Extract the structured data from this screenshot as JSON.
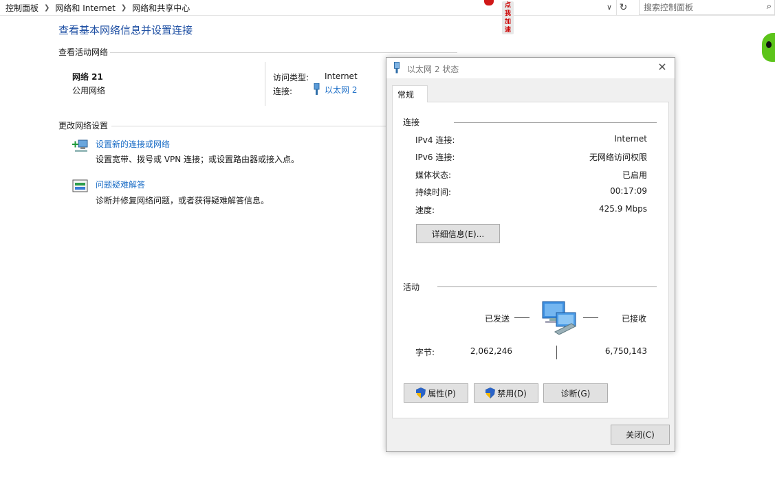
{
  "breadcrumb": [
    "控制面板",
    "网络和 Internet",
    "网络和共享中心"
  ],
  "promo": {
    "label": "点我加速",
    "color": "#d01818"
  },
  "search": {
    "placeholder": "搜索控制面板",
    "icon": "search-icon"
  },
  "page": {
    "title": "查看基本网络信息并设置连接",
    "active_networks_heading": "查看活动网络",
    "network": {
      "name": "网络 21",
      "category": "公用网络",
      "access_type_label": "访问类型:",
      "access_type_value": "Internet",
      "connection_label": "连接:",
      "connection_value": "以太网 2"
    },
    "change_settings_heading": "更改网络设置",
    "tasks": [
      {
        "title": "设置新的连接或网络",
        "desc": "设置宽带、拨号或 VPN 连接；或设置路由器或接入点。",
        "icon": "new-connection-icon"
      },
      {
        "title": "问题疑难解答",
        "desc": "诊断并修复网络问题，或者获得疑难解答信息。",
        "icon": "troubleshoot-icon"
      }
    ],
    "link_color": "#1e6fc7",
    "title_color": "#1e4fa3"
  },
  "dialog": {
    "title": "以太网 2 状态",
    "tab": "常规",
    "connection_group": "连接",
    "rows": [
      {
        "label": "IPv4 连接:",
        "value": "Internet"
      },
      {
        "label": "IPv6 连接:",
        "value": "无网络访问权限"
      },
      {
        "label": "媒体状态:",
        "value": "已启用"
      },
      {
        "label": "持续时间:",
        "value": "00:17:09"
      },
      {
        "label": "速度:",
        "value": "425.9 Mbps"
      }
    ],
    "details_button": "详细信息(E)...",
    "activity_group": "活动",
    "sent_label": "已发送",
    "received_label": "已接收",
    "bytes_label": "字节:",
    "bytes_sent": "2,062,246",
    "bytes_received": "6,750,143",
    "buttons": {
      "properties": "属性(P)",
      "disable": "禁用(D)",
      "diagnose": "诊断(G)",
      "close": "关闭(C)"
    }
  }
}
